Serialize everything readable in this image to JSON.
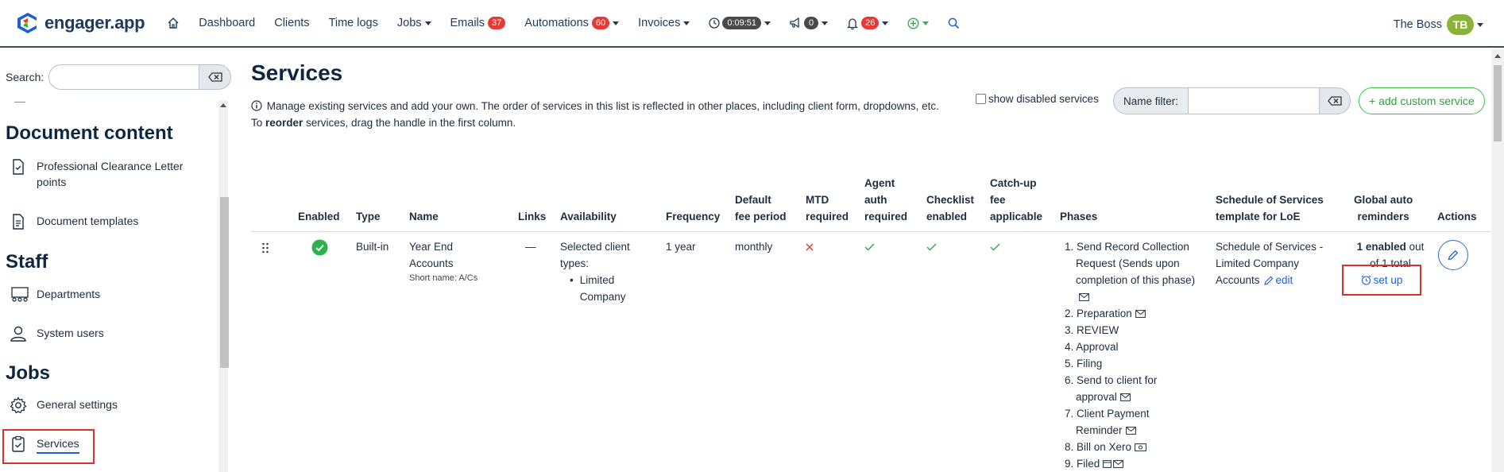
{
  "app": {
    "logo_text": "engager.app"
  },
  "nav": {
    "items": [
      {
        "label": "Dashboard"
      },
      {
        "label": "Clients"
      },
      {
        "label": "Time logs"
      },
      {
        "label": "Jobs"
      },
      {
        "label": "Emails",
        "badge": "37"
      },
      {
        "label": "Automations",
        "badge": "60"
      },
      {
        "label": "Invoices"
      }
    ],
    "timer": "0:09:51",
    "announcements_badge": "0",
    "notifications_badge": "26",
    "user_name": "The Boss",
    "user_initials": "TB"
  },
  "sidebar": {
    "search_label": "Search:",
    "sections": [
      {
        "title": "Document content",
        "items": [
          "Professional Clearance Letter points",
          "Document templates"
        ]
      },
      {
        "title": "Staff",
        "items": [
          "Departments",
          "System users"
        ]
      },
      {
        "title": "Jobs",
        "items": [
          "General settings",
          "Services"
        ]
      }
    ]
  },
  "page": {
    "title": "Services",
    "description_line1": "Manage existing services and add your own. The order of services in this list is reflected in other places, including client form, dropdowns, etc.",
    "description_line2_pre": "To ",
    "description_line2_bold": "reorder",
    "description_line2_post": " services, drag the handle in the first column.",
    "show_disabled_label": "show disabled services",
    "name_filter_label": "Name filter:",
    "add_button_label": "+ add custom service"
  },
  "table": {
    "headers": {
      "enabled": "Enabled",
      "type": "Type",
      "name": "Name",
      "links": "Links",
      "availability": "Availability",
      "frequency": "Frequency",
      "default_fee_1": "Default",
      "default_fee_2": "fee period",
      "mtd_1": "MTD",
      "mtd_2": "required",
      "agent_1": "Agent",
      "agent_2": "auth",
      "agent_3": "required",
      "checklist_1": "Checklist",
      "checklist_2": "enabled",
      "catchup_1": "Catch-up",
      "catchup_2": "fee",
      "catchup_3": "applicable",
      "phases": "Phases",
      "schedule_1": "Schedule of Services",
      "schedule_2": "template for LoE",
      "reminders_1": "Global auto",
      "reminders_2": "reminders",
      "actions": "Actions"
    },
    "row": {
      "type": "Built-in",
      "name_1": "Year End",
      "name_2": "Accounts",
      "short_name": "Short name: A/Cs",
      "links": "—",
      "availability_1": "Selected client",
      "availability_2": "types:",
      "availability_item_1": "Limited",
      "availability_item_2": "Company",
      "frequency": "1 year",
      "default_fee": "monthly",
      "phases": [
        "1. Send Record Collection",
        "Request (Sends upon",
        "completion of this phase)",
        "2. Preparation",
        "3. REVIEW",
        "4. Approval",
        "5. Filing",
        "6. Send to client for",
        "approval",
        "7. Client Payment",
        "Reminder",
        "8. Bill on Xero",
        "9. Filed"
      ],
      "schedule_1": "Schedule of Services -",
      "schedule_2": "Limited Company",
      "schedule_3": "Accounts",
      "schedule_edit": "edit",
      "reminders_bold": "1 enabled",
      "reminders_rest": " out",
      "reminders_line2": "of 1 total",
      "setup_label": "set up"
    }
  },
  "colors": {
    "accent": "#1f5fd6",
    "success": "#2bb24c",
    "danger": "#e53935",
    "navy": "#0f2640"
  }
}
